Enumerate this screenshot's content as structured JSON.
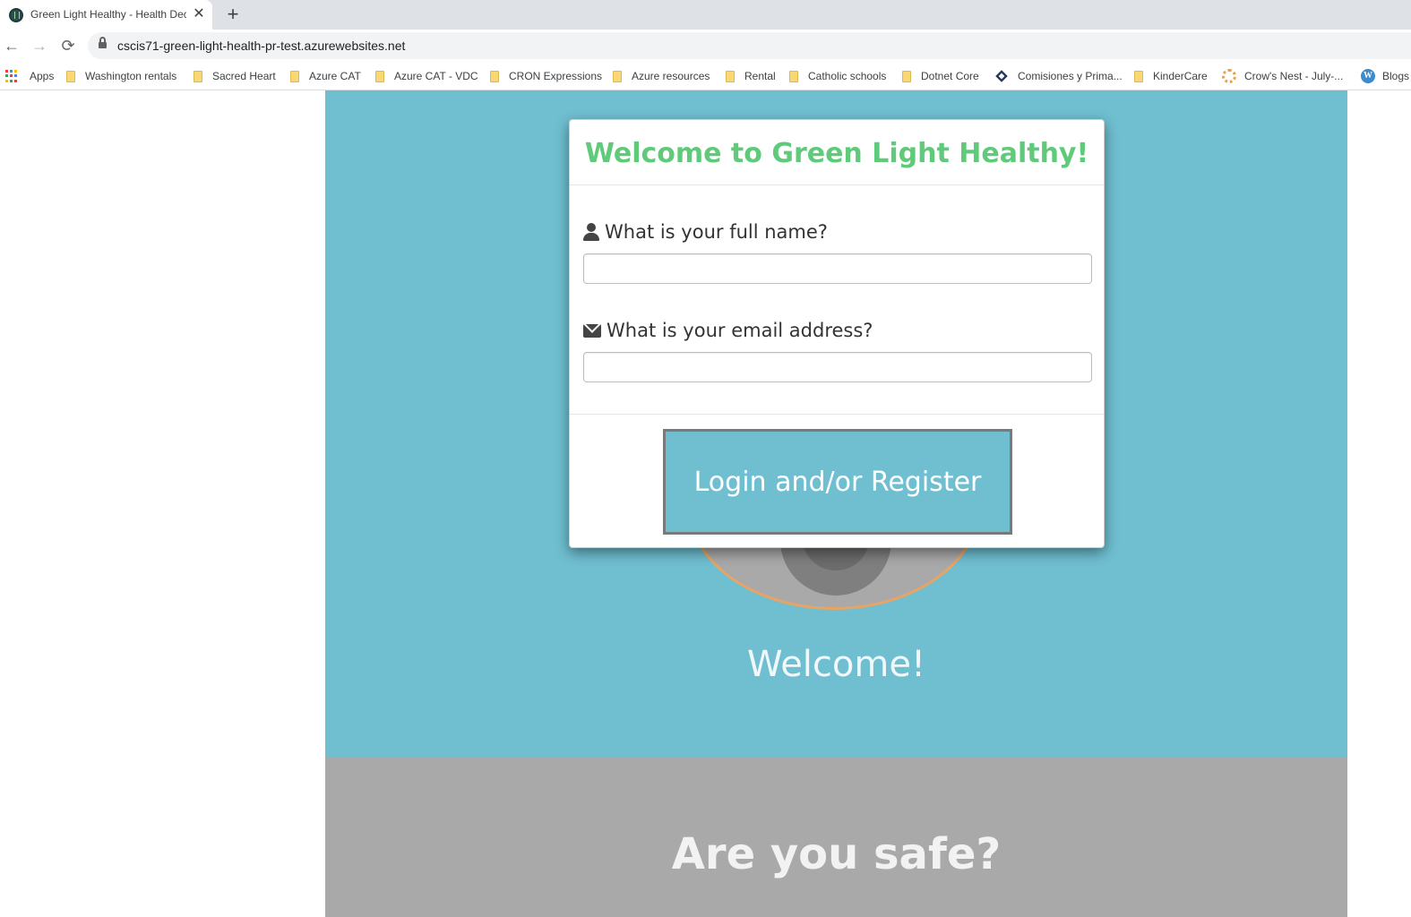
{
  "browser": {
    "tab": {
      "title": "Green Light Healthy - Health Declaration",
      "close": "✕"
    },
    "new_tab": "+",
    "nav": {
      "back": "←",
      "forward": "→",
      "reload": "⟳"
    },
    "url": "cscis71-green-light-health-pr-test.azurewebsites.net",
    "bookmarks": [
      "Apps",
      "Washington rentals",
      "Sacred Heart",
      "Azure CAT",
      "Azure CAT - VDC",
      "CRON Expressions",
      "Azure resources",
      "Rental",
      "Catholic schools",
      "Dotnet Core",
      "Comisiones y Prima...",
      "KinderCare",
      "Crow's Nest - July-...",
      "Blogs"
    ],
    "wp_glyph": "W"
  },
  "modal": {
    "title": "Welcome to Green Light Healthy!",
    "name_label": "What is your full name?",
    "name_value": "",
    "email_label": "What is your email address?",
    "email_value": "",
    "login_button": "Login and/or Register"
  },
  "hero": {
    "welcome": "Welcome!"
  },
  "safe": {
    "title": "Are you safe?"
  },
  "colors": {
    "hero_bg": "#6fbfd1",
    "title_green": "#5fcb7a",
    "safe_bg": "#a9a9a9",
    "ring_orange": "#e8a465"
  }
}
